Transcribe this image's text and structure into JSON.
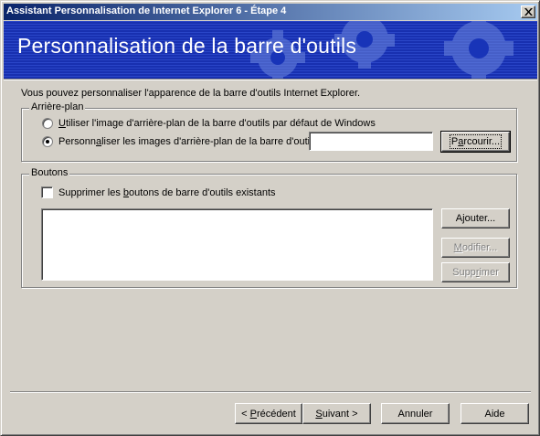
{
  "window": {
    "title": "Assistant Personnalisation de Internet Explorer 6 - Étape 4"
  },
  "banner": {
    "title": "Personnalisation de la barre d'outils"
  },
  "intro": "Vous pouvez personnaliser l'apparence de la barre d'outils Internet Explorer.",
  "background_group": {
    "label": "Arrière-plan",
    "option_default": {
      "u": "U",
      "rest": "tiliser l'image d'arrière-plan de la barre d'outils par défaut de Windows",
      "selected": false
    },
    "option_custom": {
      "pre": "Personn",
      "u": "a",
      "rest": "liser les images d'arrière-plan de la barre d'outils",
      "selected": true
    },
    "path_value": "",
    "browse_button": {
      "pre": "P",
      "u": "a",
      "rest": "rcourir..."
    }
  },
  "buttons_group": {
    "label": "Boutons",
    "delete_existing": {
      "pre": "Supprimer les ",
      "u": "b",
      "rest": "outons de barre d'outils existants",
      "checked": false
    },
    "add_button": {
      "pre": "A",
      "u": "j",
      "rest": "outer..."
    },
    "modify_button": {
      "pre": "",
      "u": "M",
      "rest": "odifier..."
    },
    "delete_button": {
      "pre": "Supp",
      "u": "r",
      "rest": "imer"
    }
  },
  "footer": {
    "prev_button": {
      "pre": "< ",
      "u": "P",
      "rest": "récédent"
    },
    "next_button": {
      "pre": "",
      "u": "S",
      "rest": "uivant >"
    },
    "cancel_button": "Annuler",
    "help_button": "Aide"
  },
  "colors": {
    "titlebar_start": "#0a246a",
    "titlebar_end": "#a6caf0",
    "banner": "#1834b8",
    "face": "#d4d0c8"
  },
  "icons": {
    "close": "close-icon",
    "banner_art": "gears-icon"
  }
}
